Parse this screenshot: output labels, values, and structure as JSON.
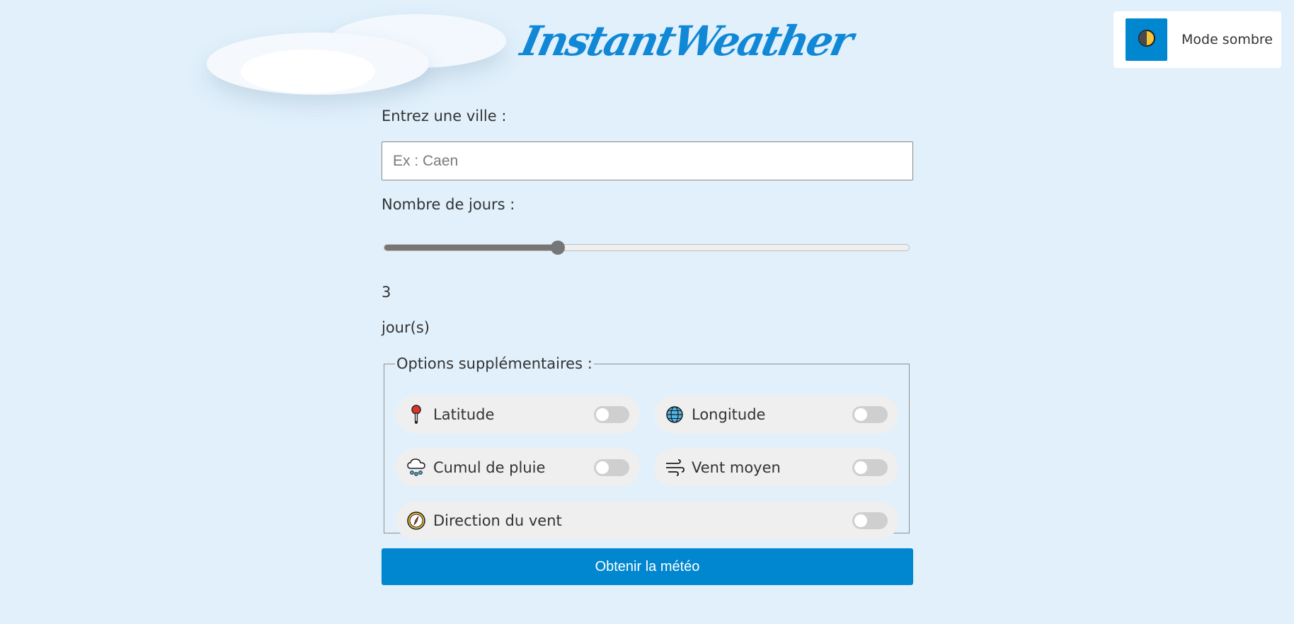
{
  "header": {
    "logo_text": "InstantWeather"
  },
  "mode_toggle": {
    "label": "Mode sombre",
    "icon": "half-moon-icon"
  },
  "form": {
    "city": {
      "label": "Entrez une ville :",
      "placeholder": "Ex : Caen",
      "value": ""
    },
    "days": {
      "label": "Nombre de jours :",
      "value": "3",
      "unit": "jour(s)",
      "slider_fraction": 0.33
    },
    "options": {
      "legend": "Options supplémentaires :",
      "items": [
        {
          "label": "Latitude",
          "icon": "pin-icon",
          "enabled": false
        },
        {
          "label": "Longitude",
          "icon": "globe-icon",
          "enabled": false
        },
        {
          "label": "Cumul de pluie",
          "icon": "rain-cloud-icon",
          "enabled": false
        },
        {
          "label": "Vent moyen",
          "icon": "wind-icon",
          "enabled": false
        },
        {
          "label": "Direction du vent",
          "icon": "compass-icon",
          "enabled": false
        }
      ]
    },
    "submit_label": "Obtenir la météo"
  },
  "colors": {
    "background": "#e1f0fb",
    "accent": "#0087d0",
    "logo": "#1188d6"
  }
}
